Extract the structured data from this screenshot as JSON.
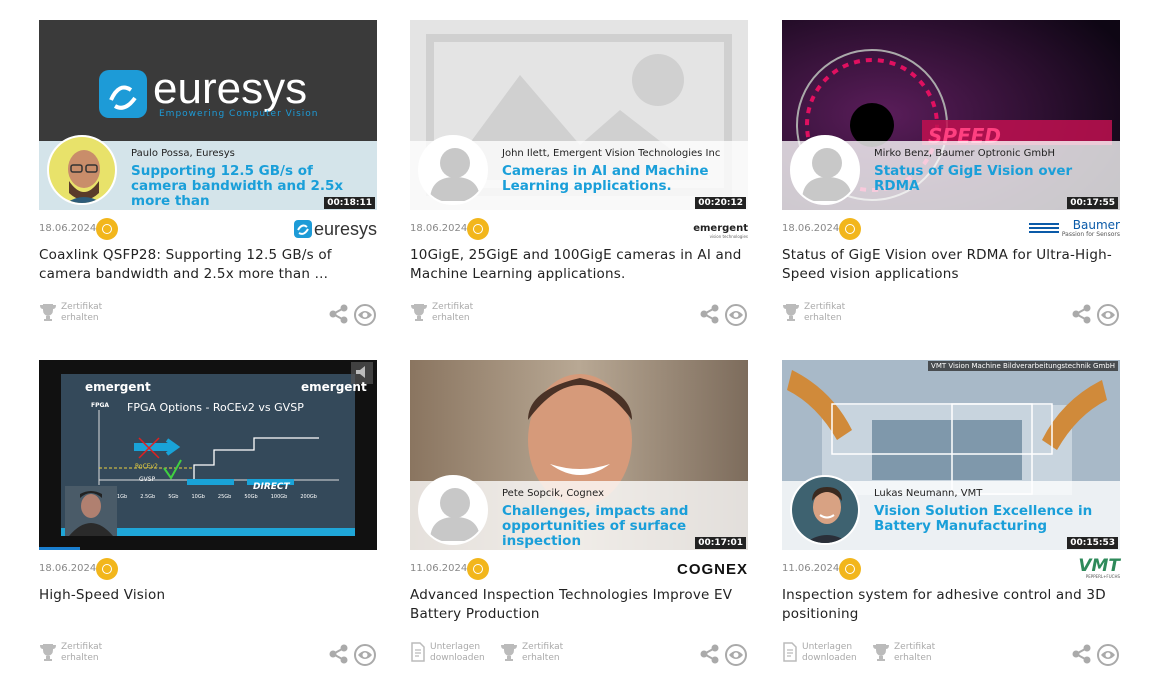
{
  "cards": [
    {
      "speaker": "Paulo Possa, Euresys",
      "talk_title": "Supporting 12.5 GB/s of camera bandwidth and 2.5x more than",
      "thumb_logo": "euresys",
      "thumb_tagline": "Empowering Computer Vision",
      "duration": "00:18:11",
      "date": "18.06.2024",
      "brand": "euresys",
      "headline": "Coaxlink QSFP28: Supporting 12.5 GB/s of camera bandwidth and 2.5x more than ...",
      "cert_label_1": "Zertifikat",
      "cert_label_2": "erhalten"
    },
    {
      "speaker": "John Ilett, Emergent Vision Technologies Inc",
      "talk_title": "Cameras in AI and Machine Learning applications.",
      "duration": "00:20:12",
      "date": "18.06.2024",
      "brand": "emergent",
      "brand_sub": "vision technologies",
      "headline": "10GigE, 25GigE and 100GigE cameras in AI and Machine Learning applications.",
      "cert_label_1": "Zertifikat",
      "cert_label_2": "erhalten"
    },
    {
      "speaker": "Mirko Benz, Baumer Optronic GmbH",
      "talk_title": "Status of GigE Vision over RDMA",
      "thumb_text": "SPEED",
      "duration": "00:17:55",
      "date": "18.06.2024",
      "brand": "Baumer",
      "brand_sub": "Passion for Sensors",
      "headline": "Status of GigE Vision over RDMA for Ultra-High-Speed vision applications",
      "cert_label_1": "Zertifikat",
      "cert_label_2": "erhalten"
    },
    {
      "slide_logo": "emergent",
      "slide_title": "FPGA Options - RoCEv2 vs GVSP",
      "slide_axis": "FPGA",
      "slide_labels": [
        "RoCEv2",
        "GVSP",
        "DIRECT"
      ],
      "slide_ticks": [
        "1Gb",
        "2.5Gb",
        "5Gb",
        "10Gb",
        "25Gb",
        "50Gb",
        "100Gb",
        "200Gb"
      ],
      "date": "18.06.2024",
      "headline": "High-Speed Vision",
      "cert_label_1": "Zertifikat",
      "cert_label_2": "erhalten",
      "progress": 0.12
    },
    {
      "speaker": "Pete Sopcik, Cognex",
      "talk_title": "Challenges, impacts and opportunities of surface inspection",
      "duration": "00:17:01",
      "date": "11.06.2024",
      "brand": "COGNEX",
      "headline": "Advanced Inspection Technologies Improve EV Battery Production",
      "dl_label_1": "Unterlagen",
      "dl_label_2": "downloaden",
      "cert_label_1": "Zertifikat",
      "cert_label_2": "erhalten"
    },
    {
      "thumb_caption": "VMT Vision Machine Bildverarbeitungstechnik GmbH",
      "speaker": "Lukas Neumann, VMT",
      "talk_title": "Vision Solution Excellence in Battery Manufacturing",
      "duration": "00:15:53",
      "date": "11.06.2024",
      "brand": "VMT",
      "brand_sub": "PEPPERL+FUCHS",
      "headline": "Inspection system for adhesive control and 3D positioning",
      "dl_label_1": "Unterlagen",
      "dl_label_2": "downloaden",
      "cert_label_1": "Zertifikat",
      "cert_label_2": "erhalten"
    }
  ],
  "colors": {
    "accent": "#1a9fd9",
    "badge": "#f2b61c",
    "euresys_blue": "#1d9bd7",
    "baumer_blue": "#0a5aa8",
    "vmt_green": "#2e8a5a"
  },
  "icons": [
    "certificate-icon",
    "share-icon",
    "eye-icon",
    "download-doc-icon",
    "mute-icon",
    "user-placeholder-icon"
  ]
}
